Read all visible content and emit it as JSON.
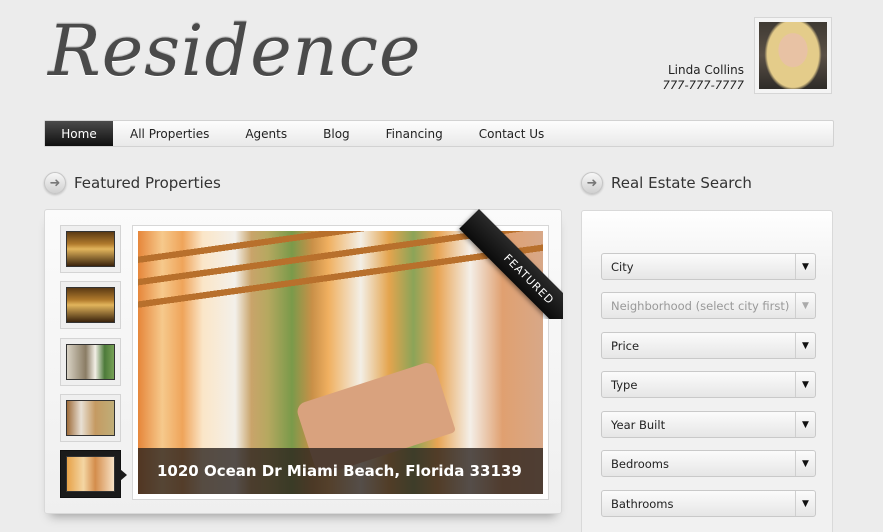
{
  "header": {
    "logo": "Residence",
    "agent_name": "Linda Collins",
    "agent_phone": "777-777-7777"
  },
  "nav": {
    "items": [
      {
        "label": "Home",
        "active": true
      },
      {
        "label": "All Properties"
      },
      {
        "label": "Agents"
      },
      {
        "label": "Blog"
      },
      {
        "label": "Financing"
      },
      {
        "label": "Contact Us"
      }
    ]
  },
  "featured": {
    "title": "Featured Properties",
    "ribbon": "FEATURED",
    "caption": "1020 Ocean Dr Miami Beach, Florida 33139",
    "thumbnails": [
      "thumbnail-1",
      "thumbnail-2",
      "thumbnail-3",
      "thumbnail-4",
      "thumbnail-5"
    ],
    "active_thumbnail": 5
  },
  "search": {
    "title": "Real Estate Search",
    "fields": [
      {
        "label": "City",
        "disabled": false
      },
      {
        "label": "Neighborhood (select city first)",
        "disabled": true
      },
      {
        "label": "Price",
        "disabled": false
      },
      {
        "label": "Type",
        "disabled": false
      },
      {
        "label": "Year Built",
        "disabled": false
      },
      {
        "label": "Bedrooms",
        "disabled": false
      },
      {
        "label": "Bathrooms",
        "disabled": false
      }
    ]
  },
  "icons": {
    "section_arrow": "arrow-right-circle-icon",
    "dropdown": "chevron-down-icon"
  },
  "colors": {
    "background": "#ececec",
    "nav_active": "#1b1b1b",
    "caption_overlay": "#28201c"
  }
}
